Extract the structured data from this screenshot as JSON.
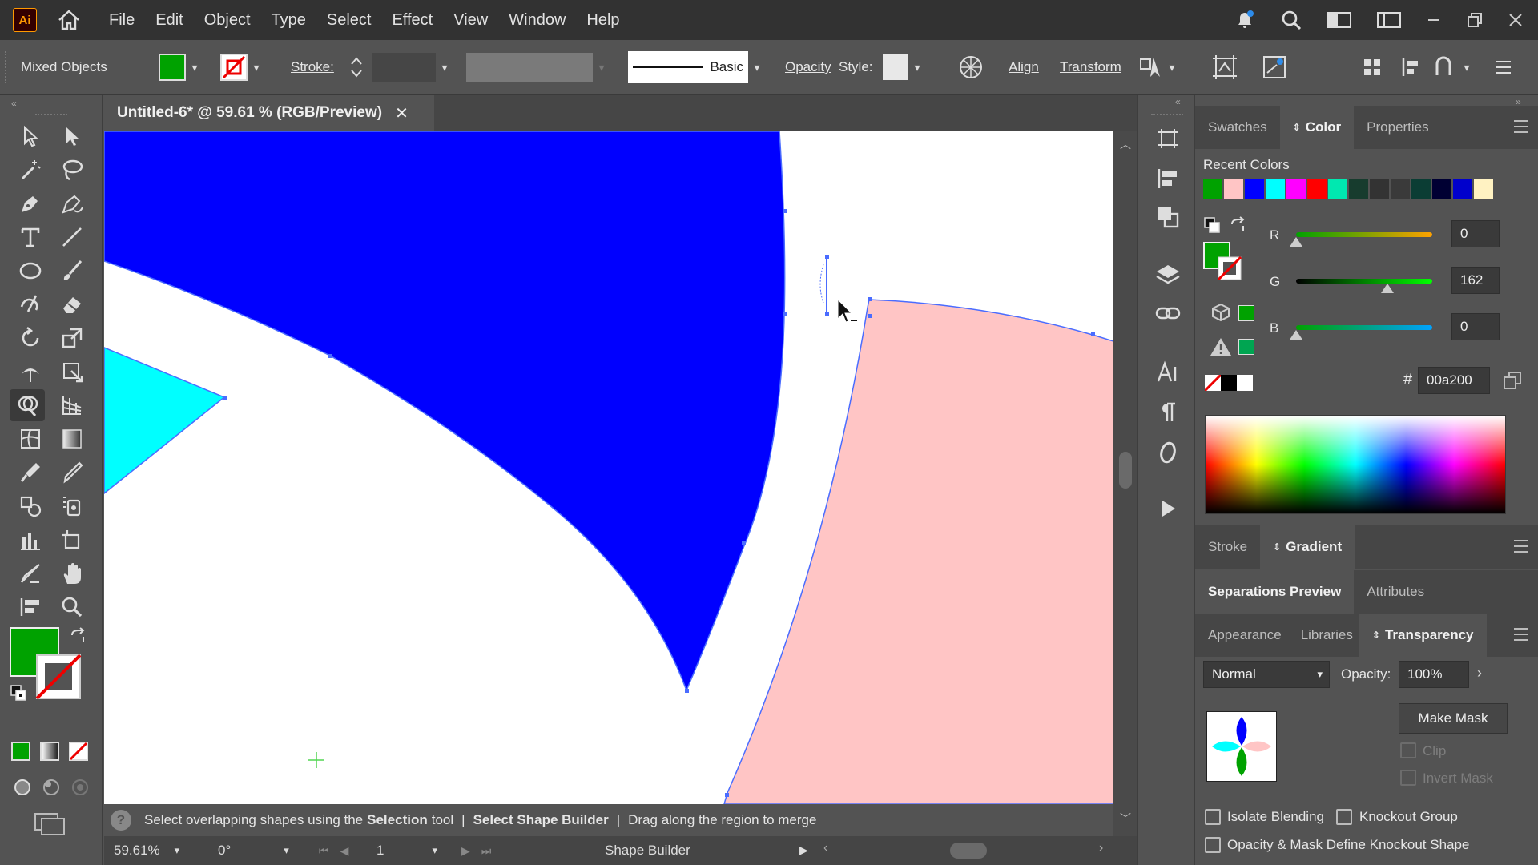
{
  "app": {
    "logo": "Ai",
    "menu": [
      "File",
      "Edit",
      "Object",
      "Type",
      "Select",
      "Effect",
      "View",
      "Window",
      "Help"
    ]
  },
  "control": {
    "selection_label": "Mixed Objects",
    "stroke_label": "Stroke:",
    "brush_label": "Basic",
    "opacity_label": "Opacity",
    "style_label": "Style:",
    "align_label": "Align",
    "transform_label": "Transform",
    "fill_color": "#00a200"
  },
  "document": {
    "tab_title": "Untitled-6* @ 59.61 % (RGB/Preview)"
  },
  "hint": {
    "text1": "Select overlapping shapes using the",
    "bold1": "Selection",
    "text2": "tool",
    "sep": "|",
    "bold2": "Select Shape Builder",
    "text3": "Drag along the region to merge"
  },
  "status": {
    "zoom": "59.61%",
    "rotation": "0°",
    "artboard": "1",
    "tool": "Shape Builder"
  },
  "panels": {
    "top_tabs": [
      "Swatches",
      "Color",
      "Properties"
    ],
    "recent_colors_label": "Recent Colors",
    "recent_colors": [
      "#00a200",
      "#ffc5c5",
      "#0000ff",
      "#00ffff",
      "#ff00ff",
      "#ff0000",
      "#00e8b0",
      "#173c2e",
      "#333333",
      "#3a3a3a",
      "#0b3d34",
      "#000033",
      "#0000cc",
      "#fff2c2"
    ],
    "r_label": "R",
    "r_value": "0",
    "g_label": "G",
    "g_value": "162",
    "b_label": "B",
    "b_value": "0",
    "hash": "#",
    "hex_value": "00a200",
    "mid_tabs": [
      "Stroke",
      "Gradient"
    ],
    "sep_tabs": [
      "Separations Preview",
      "Attributes"
    ],
    "trans_tabs": [
      "Appearance",
      "Libraries",
      "Transparency"
    ],
    "blend_mode": "Normal",
    "opacity_label": "Opacity:",
    "opacity_value": "100%",
    "make_mask": "Make Mask",
    "clip": "Clip",
    "invert_mask": "Invert Mask",
    "isolate_blending": "Isolate Blending",
    "knockout_group": "Knockout Group",
    "opacity_mask_knockout": "Opacity & Mask Define Knockout Shape"
  },
  "canvas": {
    "shape_colors": {
      "blue": "#0000ff",
      "cyan": "#00ffff",
      "pink": "#ffc5c5",
      "selection": "#4a6cff"
    }
  }
}
